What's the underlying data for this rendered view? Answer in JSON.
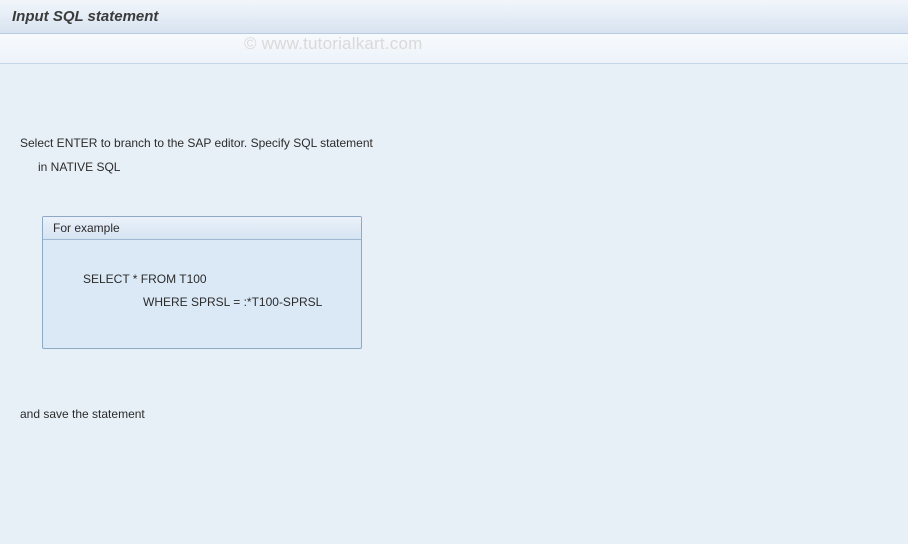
{
  "header": {
    "title": "Input SQL statement"
  },
  "content": {
    "instruction_line1": "Select ENTER to branch to the SAP editor. Specify SQL statement",
    "instruction_line2": "in NATIVE SQL",
    "save_line": "and save the statement"
  },
  "example_box": {
    "header": "For example",
    "line1": "SELECT * FROM T100",
    "line2": "WHERE SPRSL = :*T100-SPRSL"
  },
  "watermark": "© www.tutorialkart.com"
}
